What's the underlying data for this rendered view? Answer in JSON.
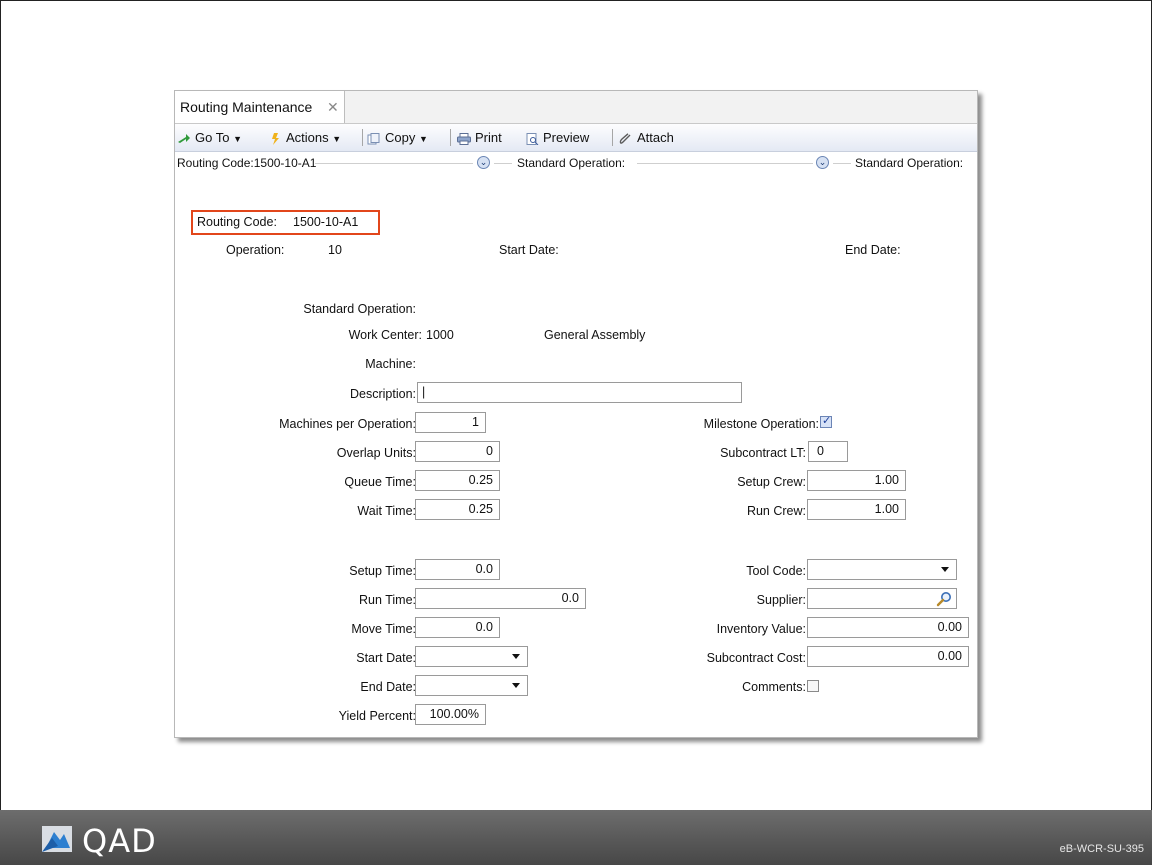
{
  "window": {
    "tab_title": "Routing Maintenance",
    "tab_close": "✕"
  },
  "toolbar": {
    "goto": "Go To",
    "actions": "Actions",
    "copy": "Copy",
    "print": "Print",
    "preview": "Preview",
    "attach": "Attach"
  },
  "breadcrumb": {
    "routing": "Routing Code:1500-10-A1",
    "std_op_1": "Standard Operation:",
    "std_op_2": "Standard Operation:"
  },
  "header": {
    "routing_code_label": "Routing Code:",
    "routing_code_value": "1500-10-A1",
    "operation_label": "Operation:",
    "operation_value": "10",
    "start_date_label": "Start Date:",
    "end_date_label": "End Date:"
  },
  "form": {
    "standard_operation_label": "Standard Operation:",
    "work_center_label": "Work Center:",
    "work_center_value": "1000",
    "work_center_desc": "General Assembly",
    "machine_label": "Machine:",
    "description_label": "Description:",
    "description_value": "|",
    "machines_per_op_label": "Machines per Operation:",
    "machines_per_op_value": "1",
    "overlap_units_label": "Overlap Units:",
    "overlap_units_value": "0",
    "queue_time_label": "Queue Time:",
    "queue_time_value": "0.25",
    "wait_time_label": "Wait Time:",
    "wait_time_value": "0.25",
    "milestone_label": "Milestone Operation:",
    "milestone_checked": true,
    "subcontract_lt_label": "Subcontract LT:",
    "subcontract_lt_value": "0",
    "setup_crew_label": "Setup Crew:",
    "setup_crew_value": "1.00",
    "run_crew_label": "Run Crew:",
    "run_crew_value": "1.00",
    "setup_time_label": "Setup Time:",
    "setup_time_value": "0.0",
    "run_time_label": "Run Time:",
    "run_time_value": "0.0",
    "move_time_label": "Move Time:",
    "move_time_value": "0.0",
    "start_date_label": "Start Date:",
    "end_date_label": "End Date:",
    "yield_percent_label": "Yield Percent:",
    "yield_percent_value": "100.00%",
    "tool_code_label": "Tool Code:",
    "supplier_label": "Supplier:",
    "inventory_value_label": "Inventory Value:",
    "inventory_value_value": "0.00",
    "subcontract_cost_label": "Subcontract Cost:",
    "subcontract_cost_value": "0.00",
    "comments_label": "Comments:",
    "comments_checked": false
  },
  "footer": {
    "brand": "QAD",
    "slide_code": "eB-WCR-SU-395"
  },
  "colors": {
    "highlight": "#e2461b",
    "footer": "#555555",
    "toolbar": "#e4e9f4"
  }
}
